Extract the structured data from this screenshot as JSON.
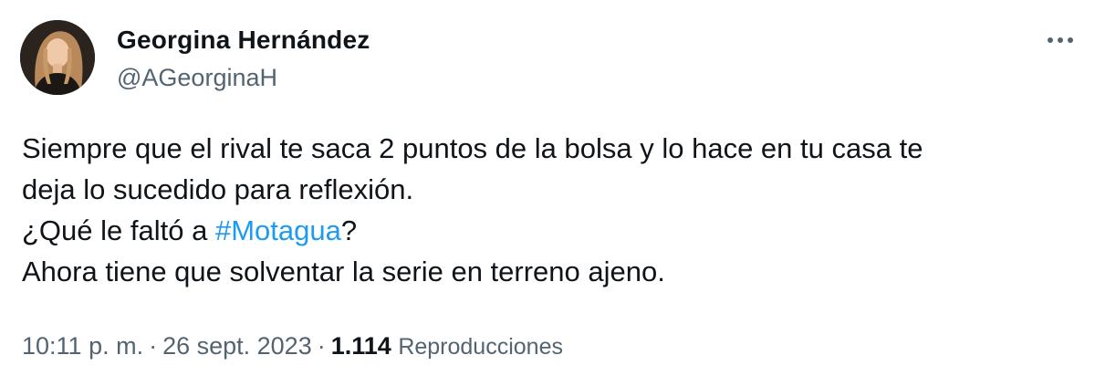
{
  "author": {
    "name": "Georgina Hernández",
    "handle": "@AGeorginaH"
  },
  "more_icon": "more-horizontal-icon",
  "tweet": {
    "line1": "Siempre que el rival te saca 2 puntos de la bolsa y lo hace en tu casa te",
    "line2": "deja lo sucedido para reflexión.",
    "line3_prefix": "¿Qué le faltó a ",
    "line3_hashtag": "#Motagua",
    "line3_suffix": "?",
    "line4": "Ahora tiene que solventar la serie en terreno ajeno."
  },
  "meta": {
    "time": "10:11 p. m.",
    "separator": "·",
    "date": "26 sept. 2023",
    "views_count": "1.114",
    "views_label": "Reproducciones"
  },
  "colors": {
    "text": "#0f1419",
    "secondary": "#536471",
    "link": "#1d9bf0"
  }
}
